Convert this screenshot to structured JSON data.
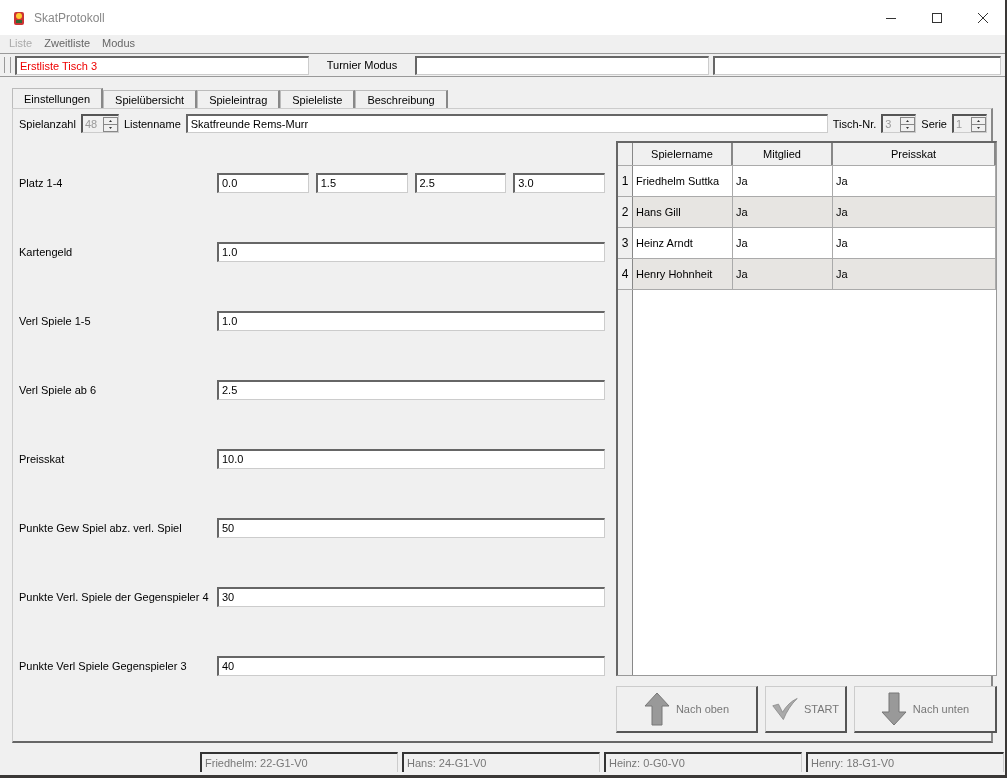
{
  "window": {
    "title": "SkatProtokoll"
  },
  "menu": [
    {
      "label": "Liste",
      "disabled": true
    },
    {
      "label": "Zweitliste",
      "disabled": false
    },
    {
      "label": "Modus",
      "disabled": false
    }
  ],
  "toolbar": {
    "list_field": "Erstliste Tisch 3",
    "mode_label": "Turnier Modus"
  },
  "tabs": [
    {
      "label": "Einstellungen",
      "selected": true
    },
    {
      "label": "Spielübersicht",
      "selected": false
    },
    {
      "label": "Spieleintrag",
      "selected": false
    },
    {
      "label": "Spieleliste",
      "selected": false
    },
    {
      "label": "Beschreibung",
      "selected": false
    }
  ],
  "header": {
    "games_label": "Spielanzahl",
    "games_value": "48",
    "list_name_label": "Listenname",
    "list_name": "Skatfreunde Rems-Murr",
    "table_label": "Tisch-Nr.",
    "table_value": "3",
    "series_label": "Serie",
    "series_value": "1"
  },
  "settings": [
    {
      "label": "Platz 1-4",
      "values": [
        "0.0",
        "1.5",
        "2.5",
        "3.0"
      ]
    },
    {
      "label": "Kartengeld",
      "values": [
        "1.0"
      ]
    },
    {
      "label": "Verl Spiele 1-5",
      "values": [
        "1.0"
      ]
    },
    {
      "label": "Verl Spiele ab 6",
      "values": [
        "2.5"
      ]
    },
    {
      "label": "Preisskat",
      "values": [
        "10.0"
      ]
    },
    {
      "label": "Punkte Gew Spiel abz. verl. Spiel",
      "values": [
        "50"
      ]
    },
    {
      "label": "Punkte Verl. Spiele der Gegenspieler 4",
      "values": [
        "30"
      ]
    },
    {
      "label": "Punkte Verl Spiele Gegenspieler 3",
      "values": [
        "40"
      ]
    }
  ],
  "players_table": {
    "columns": [
      "Spielername",
      "Mitglied",
      "Preisskat"
    ],
    "rows": [
      {
        "number": "1",
        "cells": [
          "Friedhelm Suttka",
          "Ja",
          "Ja"
        ]
      },
      {
        "number": "2",
        "cells": [
          "Hans Gill",
          "Ja",
          "Ja"
        ]
      },
      {
        "number": "3",
        "cells": [
          "Heinz Arndt",
          "Ja",
          "Ja"
        ]
      },
      {
        "number": "4",
        "cells": [
          "Henry Hohnheit",
          "Ja",
          "Ja"
        ]
      }
    ]
  },
  "buttons": [
    {
      "kind": "up",
      "label": "Nach oben",
      "disabled": true
    },
    {
      "kind": "check",
      "label": "START",
      "disabled": true
    },
    {
      "kind": "down",
      "label": "Nach unten",
      "disabled": true
    }
  ],
  "status_bar": [
    "Friedhelm: 22-G1-V0",
    "Hans: 24-G1-V0",
    "Heinz: 0-G0-V0",
    "Henry: 18-G1-V0"
  ]
}
